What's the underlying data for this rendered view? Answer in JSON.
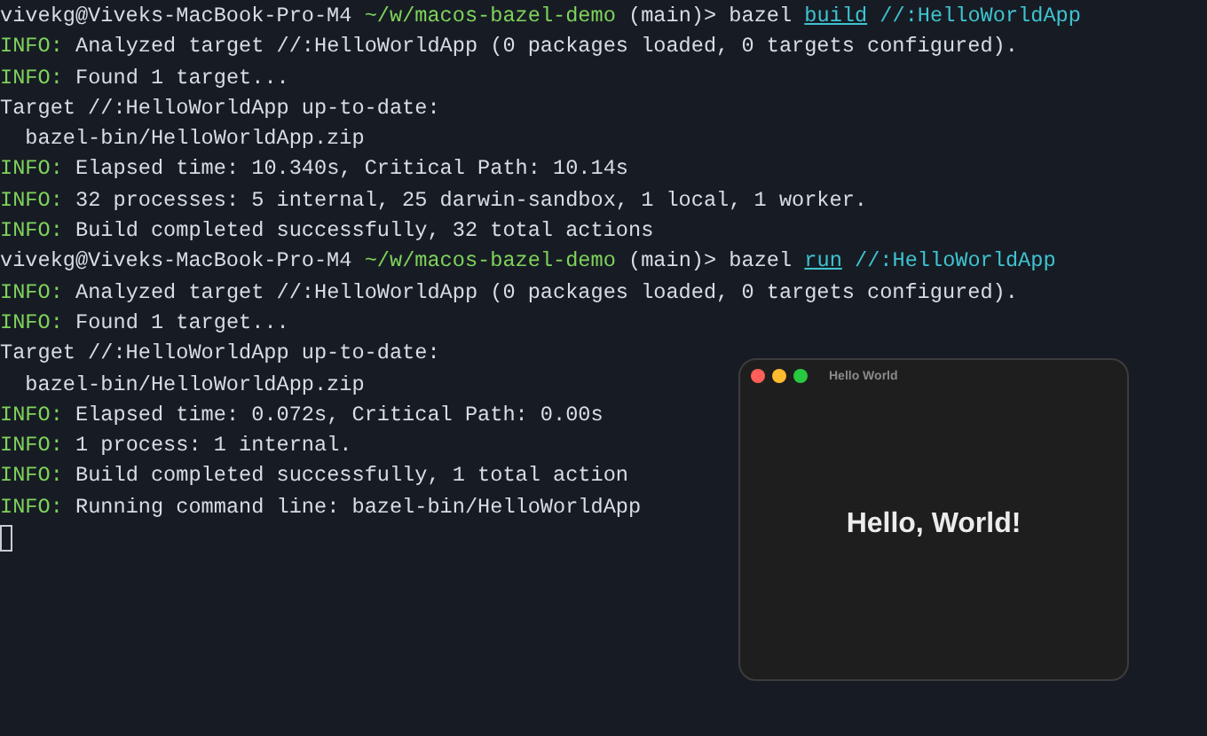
{
  "terminal": {
    "lines": [
      {
        "kind": "prompt",
        "user_host": "vivekg@Viveks-MacBook-Pro-M4",
        "path": "~/w/macos-bazel-demo",
        "branch": "(main)>",
        "program": "bazel",
        "subcommand": "build",
        "target": "//:HelloWorldApp"
      },
      {
        "kind": "info",
        "label": "INFO:",
        "text": "Analyzed target //:HelloWorldApp (0 packages loaded, 0 targets configured)."
      },
      {
        "kind": "info",
        "label": "INFO:",
        "text": "Found 1 target..."
      },
      {
        "kind": "plain",
        "text": "Target //:HelloWorldApp up-to-date:"
      },
      {
        "kind": "plain",
        "text": "  bazel-bin/HelloWorldApp.zip"
      },
      {
        "kind": "info",
        "label": "INFO:",
        "text": "Elapsed time: 10.340s, Critical Path: 10.14s"
      },
      {
        "kind": "info",
        "label": "INFO:",
        "text": "32 processes: 5 internal, 25 darwin-sandbox, 1 local, 1 worker."
      },
      {
        "kind": "info",
        "label": "INFO:",
        "text": "Build completed successfully, 32 total actions"
      },
      {
        "kind": "prompt",
        "user_host": "vivekg@Viveks-MacBook-Pro-M4",
        "path": "~/w/macos-bazel-demo",
        "branch": "(main)>",
        "program": "bazel",
        "subcommand": "run",
        "target": "//:HelloWorldApp"
      },
      {
        "kind": "info",
        "label": "INFO:",
        "text": "Analyzed target //:HelloWorldApp (0 packages loaded, 0 targets configured)."
      },
      {
        "kind": "info",
        "label": "INFO:",
        "text": "Found 1 target..."
      },
      {
        "kind": "plain",
        "text": "Target //:HelloWorldApp up-to-date:"
      },
      {
        "kind": "plain",
        "text": "  bazel-bin/HelloWorldApp.zip"
      },
      {
        "kind": "info",
        "label": "INFO:",
        "text": "Elapsed time: 0.072s, Critical Path: 0.00s"
      },
      {
        "kind": "info",
        "label": "INFO:",
        "text": "1 process: 1 internal."
      },
      {
        "kind": "info",
        "label": "INFO:",
        "text": "Build completed successfully, 1 total action"
      },
      {
        "kind": "info",
        "label": "INFO:",
        "text": "Running command line: bazel-bin/HelloWorldApp"
      },
      {
        "kind": "cursor"
      }
    ]
  },
  "app_window": {
    "title": "Hello World",
    "message": "Hello, World!"
  }
}
